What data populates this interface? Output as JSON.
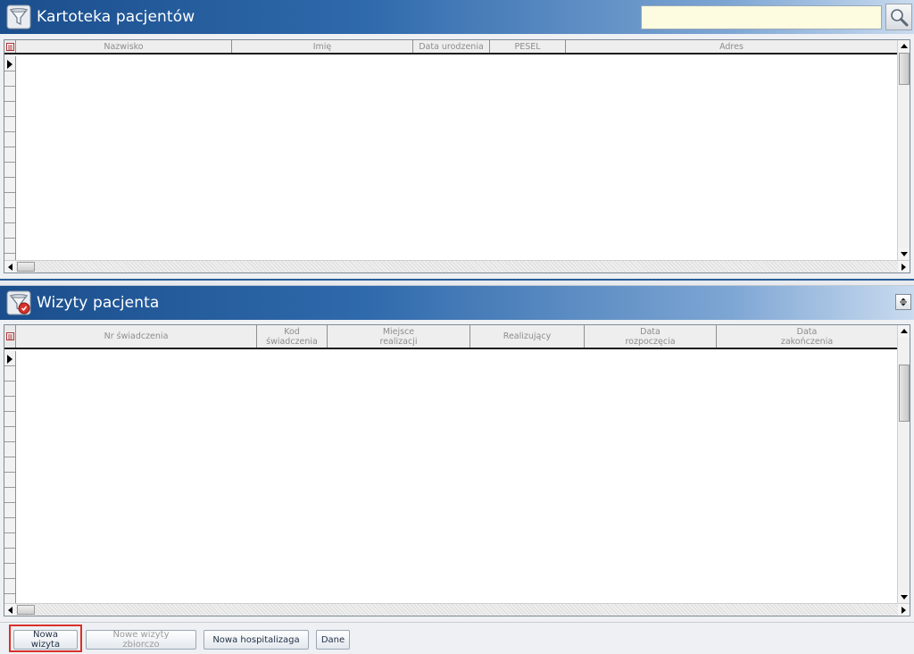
{
  "patients": {
    "title": "Kartoteka pacjentów",
    "search_value": "",
    "columns": [
      "Nazwisko",
      "Imię",
      "Data urodzenia",
      "PESEL",
      "Adres"
    ]
  },
  "visits": {
    "title": "Wizyty pacjenta",
    "columns": [
      "Nr świadczenia",
      "Kod\nświadczenia",
      "Miejsce\nrealizacji",
      "Realizujący",
      "Data\nrozpoczęcia",
      "Data\nzakończenia"
    ]
  },
  "toolbar": {
    "new_visit": "Nowa wizyta",
    "new_visits_bulk": "Nowe wizyty zbiorczo",
    "new_hospitalization": "Nowa hospitalizaga",
    "data": "Dane"
  },
  "colors": {
    "header_blue": "#1b4e8c",
    "search_bg": "#fdfbe0",
    "highlight_red": "#d9302a"
  }
}
